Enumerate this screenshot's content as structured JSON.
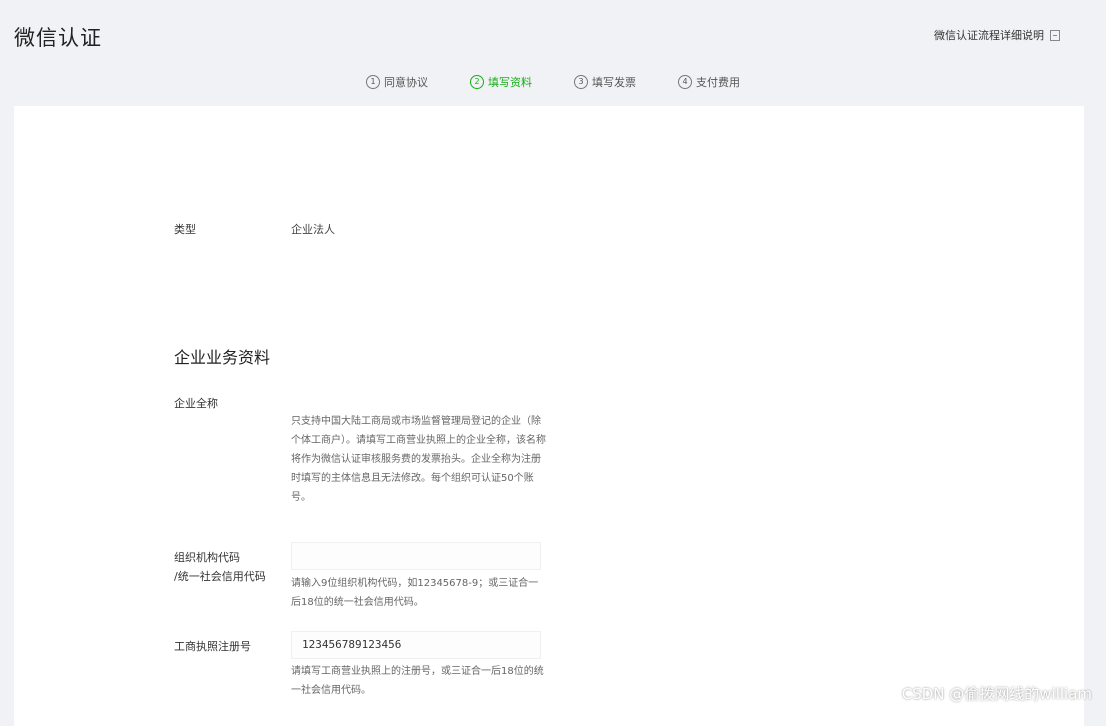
{
  "header": {
    "title": "微信认证",
    "guide_link": "微信认证流程详细说明"
  },
  "steps": [
    {
      "num": "1",
      "label": "同意协议",
      "active": false
    },
    {
      "num": "2",
      "label": "填写资料",
      "active": true
    },
    {
      "num": "3",
      "label": "填写发票",
      "active": false
    },
    {
      "num": "4",
      "label": "支付费用",
      "active": false
    }
  ],
  "form": {
    "type_label": "类型",
    "type_value": "企业法人",
    "section_title": "企业业务资料",
    "company_name_label": "企业全称",
    "company_name_desc": "只支持中国大陆工商局或市场监督管理局登记的企业（除个体工商户）。请填写工商营业执照上的企业全称，该名称将作为微信认证审核服务费的发票抬头。企业全称为注册时填写的主体信息且无法修改。每个组织可认证50个账号。",
    "org_code_label_line1": "组织机构代码",
    "org_code_label_line2": "/统一社会信用代码",
    "org_code_value": "",
    "org_code_desc": "请输入9位组织机构代码，如12345678-9；或三证合一后18位的统一社会信用代码。",
    "reg_no_label": "工商执照注册号",
    "reg_no_value": "123456789123456",
    "reg_no_desc": "请填写工商营业执照上的注册号，或三证合一后18位的统一社会信用代码。"
  },
  "watermark": "CSDN @偷拨网线的william"
}
